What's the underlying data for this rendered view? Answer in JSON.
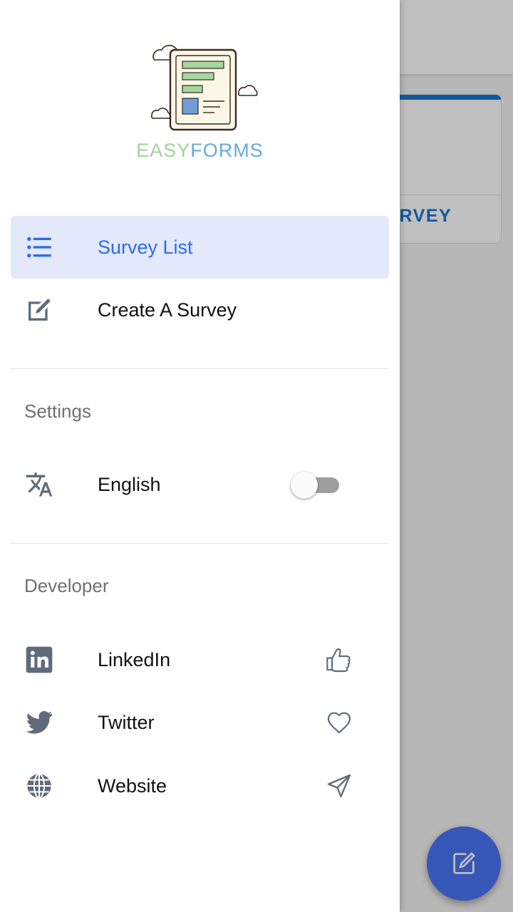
{
  "app": {
    "logo_easy": "EASY",
    "logo_forms": "FORMS"
  },
  "nav": {
    "items": [
      {
        "label": "Survey List",
        "icon": "list-icon",
        "active": true
      },
      {
        "label": "Create A Survey",
        "icon": "edit-icon",
        "active": false
      }
    ]
  },
  "settings": {
    "title": "Settings",
    "language": {
      "label": "English",
      "icon": "translate-icon",
      "toggle_on": false
    }
  },
  "developer": {
    "title": "Developer",
    "links": [
      {
        "label": "LinkedIn",
        "icon": "linkedin-icon",
        "action_icon": "thumbs-up-icon"
      },
      {
        "label": "Twitter",
        "icon": "twitter-icon",
        "action_icon": "heart-icon"
      },
      {
        "label": "Website",
        "icon": "globe-icon",
        "action_icon": "send-icon"
      }
    ]
  },
  "background": {
    "card_action": "URVEY",
    "fab_icon": "edit-icon"
  },
  "colors": {
    "accent": "#2f6aee",
    "active_bg": "#e3e8fb",
    "icon": "#5f6b7a",
    "fab": "#4a74f6",
    "card_accent": "#1976d2"
  }
}
